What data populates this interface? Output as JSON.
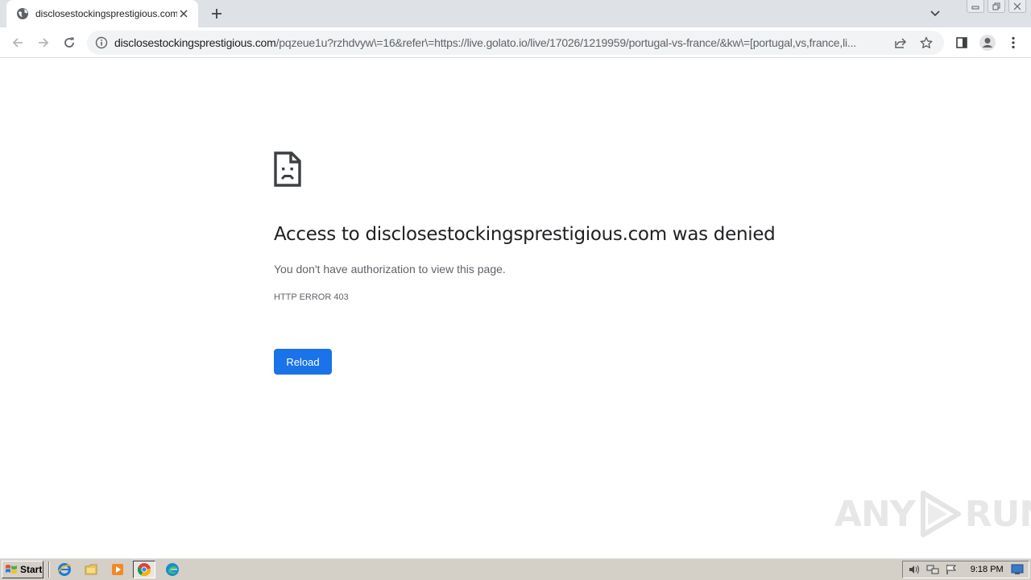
{
  "tab": {
    "title": "disclosestockingsprestigious.com",
    "favicon": "globe-icon"
  },
  "address_bar": {
    "host": "disclosestockingsprestigious.com",
    "path": "/pqzeue1u?rzhdvyw\\=16&refer\\=https://live.golato.io/live/17026/1219959/portugal-vs-france/&kw\\=[portugal,vs,france,li..."
  },
  "page": {
    "title": "Access to disclosestockingsprestigious.com was denied",
    "description": "You don't have authorization to view this page.",
    "error_code": "HTTP ERROR 403",
    "reload_label": "Reload"
  },
  "watermark": {
    "left": "ANY",
    "right": "RUN"
  },
  "taskbar": {
    "start_label": "Start",
    "clock": "9:18 PM"
  },
  "colors": {
    "accent": "#1a73e8",
    "tabstrip": "#dee1e6",
    "taskbar": "#d4d0c8"
  }
}
